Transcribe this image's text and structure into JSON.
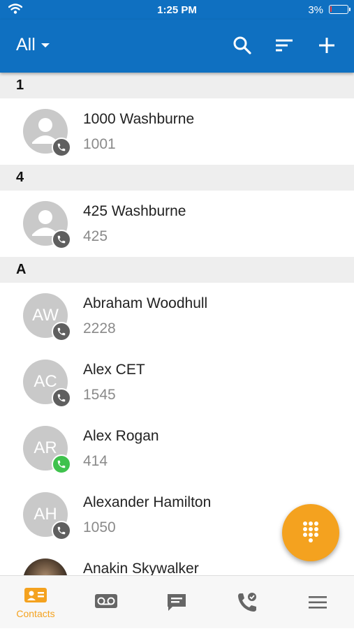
{
  "status_bar": {
    "time": "1:25 PM",
    "battery": "3%"
  },
  "app_bar": {
    "filter_label": "All"
  },
  "sections": [
    {
      "header": "1",
      "contacts": [
        {
          "name": "1000 Washburne",
          "number": "1001",
          "initials": "",
          "status": "gray"
        }
      ]
    },
    {
      "header": "4",
      "contacts": [
        {
          "name": "425 Washburne",
          "number": "425",
          "initials": "",
          "status": "gray"
        }
      ]
    },
    {
      "header": "A",
      "contacts": [
        {
          "name": "Abraham Woodhull",
          "number": "2228",
          "initials": "AW",
          "status": "gray"
        },
        {
          "name": "Alex CET",
          "number": "1545",
          "initials": "AC",
          "status": "gray"
        },
        {
          "name": "Alex Rogan",
          "number": "414",
          "initials": "AR",
          "status": "green"
        },
        {
          "name": "Alexander Hamilton",
          "number": "1050",
          "initials": "AH",
          "status": "gray"
        },
        {
          "name": "Anakin Skywalker",
          "number": "",
          "initials": "",
          "status": "photo"
        }
      ]
    }
  ],
  "bottom_nav": {
    "contacts_label": "Contacts"
  },
  "colors": {
    "primary": "#0f70c1",
    "accent": "#f4a21f",
    "status_gray": "#5f5f5f",
    "status_green": "#3fc24d"
  }
}
